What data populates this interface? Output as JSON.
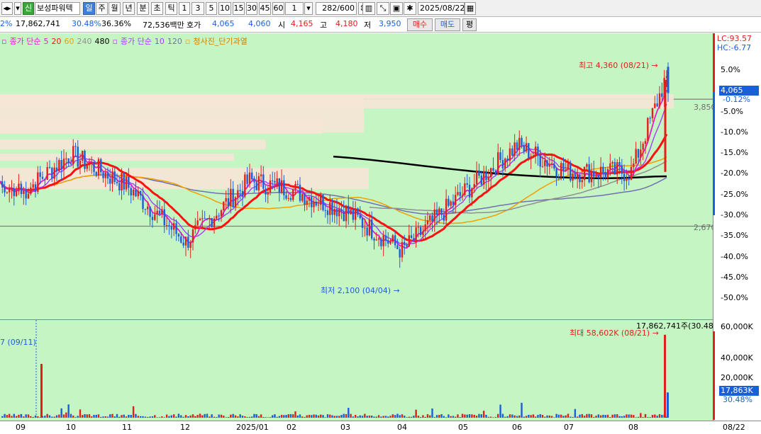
{
  "toolbar": {
    "badge": "신",
    "stock_name": "보성파워텍",
    "periods": [
      "일",
      "주",
      "월",
      "년",
      "분",
      "초",
      "틱"
    ],
    "active_period": "일",
    "intervals": [
      "1",
      "3",
      "5",
      "10",
      "15",
      "30",
      "45",
      "60"
    ],
    "interval_select": "1",
    "count": "282/600",
    "date": "2025/08/22"
  },
  "quote": {
    "prefix": "2%",
    "volume": "17,862,741",
    "turnover": "30.48%",
    "ratio": "36.36%",
    "amount": "72,536백만",
    "ask_label": "호가",
    "ask": "4,065",
    "bid": "4,060",
    "open_label": "시",
    "open": "4,165",
    "high_label": "고",
    "high": "4,180",
    "low_label": "저",
    "low": "3,950",
    "buy": "매수",
    "sell": "매도",
    "eval": "평"
  },
  "legend": {
    "ma_label": "종가 단순",
    "ma_periods": [
      "5",
      "20",
      "60",
      "240",
      "480"
    ],
    "ma2_label": "종가 단순",
    "ma2_periods": [
      "10",
      "120"
    ],
    "indicator": "청사진_단기과열"
  },
  "colors": {
    "bg": "#c6f5c4",
    "up": "#e0201a",
    "down": "#1a5fd8",
    "ma5": "#e020c8",
    "ma20": "#ff1010",
    "ma60": "#f0a000",
    "ma240": "#909090",
    "ma480": "#000000",
    "ma10": "#a040ff",
    "ma120": "#7070b0"
  },
  "annotations": {
    "high": "최고 4,360 (08/21)",
    "low": "최저 2,100 (04/04)",
    "vol_max": "최대 58,602K (08/21)",
    "vol_total": "17,862,741주(30.48%)",
    "vol_left": "7 (09/11)",
    "level_upper": "3,850",
    "level_lower": "2,670"
  },
  "right_axis": {
    "lc": "LC:93.57",
    "hc": "HC:-6.77",
    "price": "4,065",
    "price_change": "-0.12%",
    "pct_ticks": [
      "5.0%",
      "-5.0%",
      "-10.0%",
      "-15.0%",
      "-20.0%",
      "-25.0%",
      "-30.0%",
      "-35.0%",
      "-40.0%",
      "-45.0%",
      "-50.0%"
    ],
    "vol_ticks": [
      "60,000K",
      "40,000K",
      "20,000K"
    ],
    "vol_current": "17,863K",
    "vol_pct": "30.48%"
  },
  "bottom_axis": {
    "months": [
      "09",
      "10",
      "11",
      "12",
      "2025/01",
      "02",
      "03",
      "04",
      "05",
      "06",
      "07",
      "08"
    ],
    "last": "08/22"
  },
  "chart_data": {
    "type": "candlestick",
    "percent_axis_range": [
      -50,
      5
    ],
    "reference_levels": [
      3850,
      2670
    ],
    "price_extremes": {
      "high": 4360,
      "high_date": "08/21",
      "low": 2100,
      "low_date": "04/04"
    },
    "close_pct_by_month": [
      {
        "month": "09",
        "close_pct": -27
      },
      {
        "month": "10",
        "close_pct": -18
      },
      {
        "month": "11",
        "close_pct": -25
      },
      {
        "month": "12",
        "close_pct": -38
      },
      {
        "month": "2025/01",
        "close_pct": -24
      },
      {
        "month": "02",
        "close_pct": -26
      },
      {
        "month": "03",
        "close_pct": -31
      },
      {
        "month": "04",
        "close_pct": -40
      },
      {
        "month": "05",
        "close_pct": -27
      },
      {
        "month": "06",
        "close_pct": -16
      },
      {
        "month": "07",
        "close_pct": -22
      },
      {
        "month": "08",
        "close_pct": -22
      },
      {
        "month": "08/22",
        "close_pct": -0.12
      }
    ],
    "volume_axis_k": [
      0,
      60000
    ],
    "volume_max_k": 58602,
    "volume_last_k": 17863
  }
}
